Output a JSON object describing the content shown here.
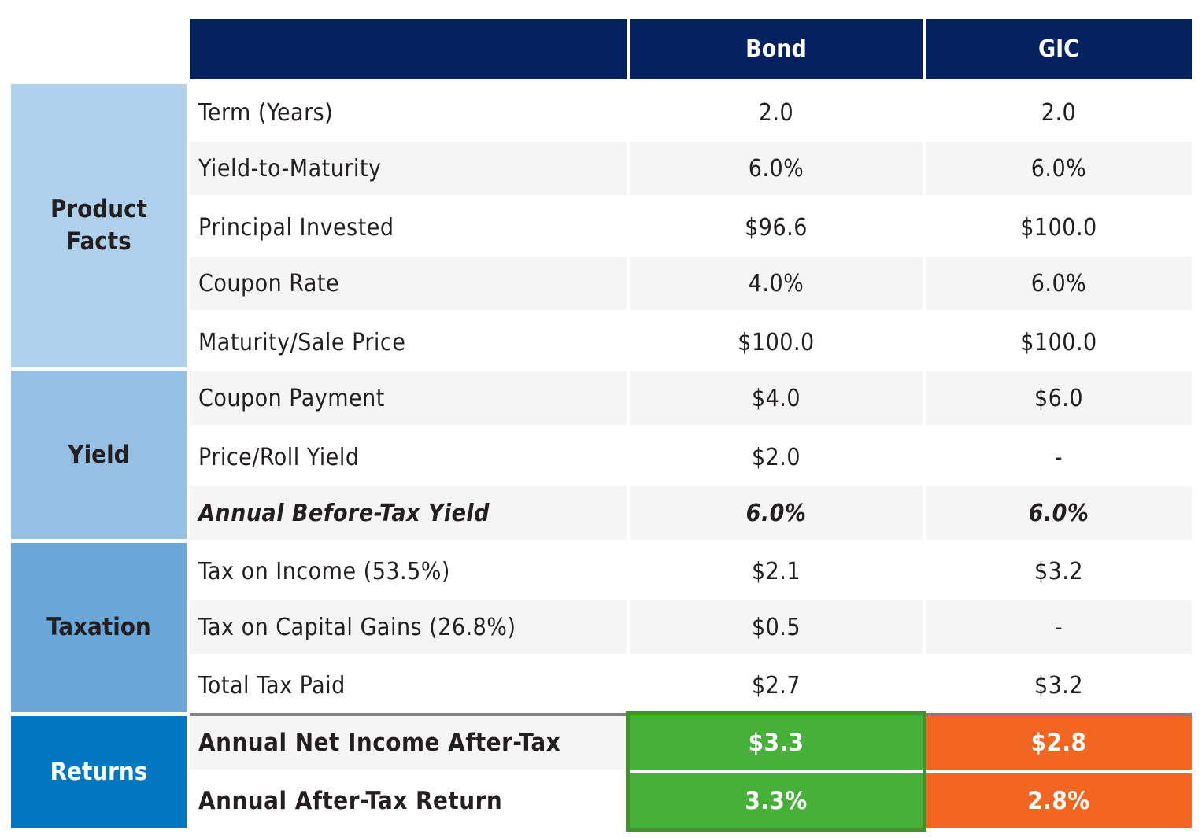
{
  "header": {
    "label_col": "",
    "columns": [
      "Bond",
      "GIC"
    ]
  },
  "groups": [
    {
      "label": "Product\nFacts",
      "line1": "Product",
      "line2": "Facts",
      "color": "#b0d1ec"
    },
    {
      "label": "Yield",
      "color": "#96c0e3"
    },
    {
      "label": "Taxation",
      "color": "#69a7d9"
    },
    {
      "label": "Returns",
      "color": "#0077c0"
    }
  ],
  "rows": [
    {
      "label": "Term (Years)",
      "bond": "2.0",
      "gic": "2.0"
    },
    {
      "label": "Yield-to-Maturity",
      "bond": "6.0%",
      "gic": "6.0%"
    },
    {
      "label": "Principal Invested",
      "bond": "$96.6",
      "gic": "$100.0"
    },
    {
      "label": "Coupon Rate",
      "bond": "4.0%",
      "gic": "6.0%"
    },
    {
      "label": "Maturity/Sale Price",
      "bond": "$100.0",
      "gic": "$100.0"
    },
    {
      "label": "Coupon Payment",
      "bond": "$4.0",
      "gic": "$6.0"
    },
    {
      "label": "Price/Roll Yield",
      "bond": "$2.0",
      "gic": "-"
    },
    {
      "label": "Annual Before-Tax Yield",
      "bond": "6.0%",
      "gic": "6.0%"
    },
    {
      "label": "Tax on Income (53.5%)",
      "bond": "$2.1",
      "gic": "$3.2"
    },
    {
      "label": "Tax on Capital Gains (26.8%)",
      "bond": "$0.5",
      "gic": "-"
    },
    {
      "label": "Total Tax Paid",
      "bond": "$2.7",
      "gic": "$3.2"
    },
    {
      "label": "Annual Net Income After-Tax",
      "bond": "$3.3",
      "gic": "$2.8"
    },
    {
      "label": "Annual After-Tax Return",
      "bond": "3.3%",
      "gic": "2.8%"
    }
  ],
  "colors": {
    "header": "#03225f",
    "bond_highlight": "#46b038",
    "bond_outline": "#468f2d",
    "gic_highlight": "#f26622"
  }
}
